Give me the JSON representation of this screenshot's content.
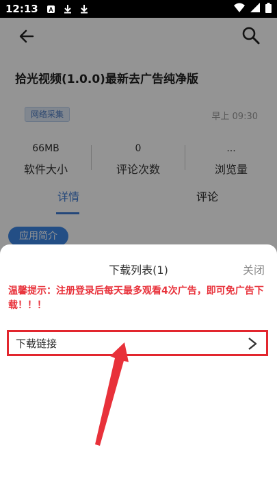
{
  "status_bar": {
    "time": "12:13",
    "icons": [
      "notification-icon",
      "download-icon",
      "download-icon",
      "wifi-icon",
      "signal-icon",
      "battery-icon"
    ]
  },
  "page": {
    "title": "拾光视频(1.0.0)最新去广告纯净版",
    "tag": "网络采集",
    "time": "早上 09:30",
    "stats": [
      {
        "value": "66MB",
        "label": "软件大小"
      },
      {
        "value": "0",
        "label": "评论次数"
      },
      {
        "value": "...",
        "label": "浏览量"
      }
    ],
    "tabs": [
      "详情",
      "评论"
    ],
    "section_pill": "应用简介"
  },
  "sheet": {
    "title": "下载列表(1)",
    "close_label": "关闭",
    "tip": "温馨提示：注册登录后每天最多观看4次广告，即可免广告下载！！！",
    "items": [
      {
        "label": "下载链接"
      }
    ]
  },
  "colors": {
    "overlay": "#000000",
    "accent": "#3f7bd3",
    "highlight": "#e2262e",
    "tip_text": "#e8313a"
  }
}
